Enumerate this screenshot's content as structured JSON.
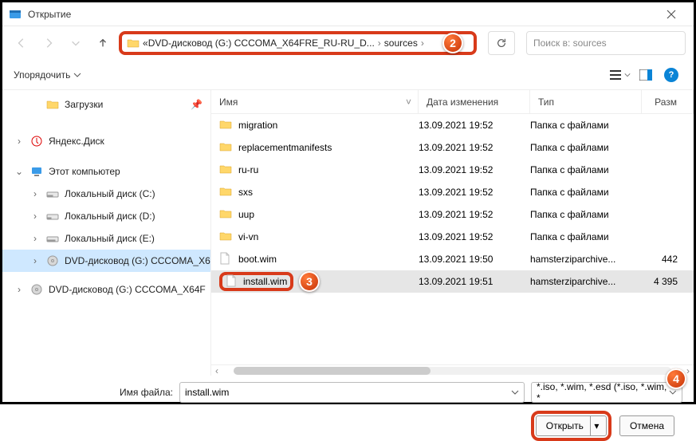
{
  "title": "Открытие",
  "breadcrumb": {
    "prefix": "«",
    "part1": "DVD-дисковод (G:) CCCOMA_X64FRE_RU-RU_D...",
    "part2": "sources"
  },
  "search_placeholder": "Поиск в: sources",
  "organize": "Упорядочить",
  "columns": {
    "name": "Имя",
    "date": "Дата изменения",
    "type": "Тип",
    "size": "Разм"
  },
  "tree": {
    "downloads": "Загрузки",
    "yandex": "Яндекс.Диск",
    "thispc": "Этот компьютер",
    "diskC": "Локальный диск (C:)",
    "diskD": "Локальный диск (D:)",
    "diskE": "Локальный диск (E:)",
    "dvd1": "DVD-дисковод (G:) CCCOMA_X6",
    "dvd2": "DVD-дисковод (G:) CCCOMA_X64F"
  },
  "files": [
    {
      "name": "migration",
      "date": "13.09.2021 19:52",
      "type": "Папка с файлами",
      "size": "",
      "kind": "folder"
    },
    {
      "name": "replacementmanifests",
      "date": "13.09.2021 19:52",
      "type": "Папка с файлами",
      "size": "",
      "kind": "folder"
    },
    {
      "name": "ru-ru",
      "date": "13.09.2021 19:52",
      "type": "Папка с файлами",
      "size": "",
      "kind": "folder"
    },
    {
      "name": "sxs",
      "date": "13.09.2021 19:52",
      "type": "Папка с файлами",
      "size": "",
      "kind": "folder"
    },
    {
      "name": "uup",
      "date": "13.09.2021 19:52",
      "type": "Папка с файлами",
      "size": "",
      "kind": "folder"
    },
    {
      "name": "vi-vn",
      "date": "13.09.2021 19:52",
      "type": "Папка с файлами",
      "size": "",
      "kind": "folder"
    },
    {
      "name": "boot.wim",
      "date": "13.09.2021 19:50",
      "type": "hamsterziparchive...",
      "size": "442",
      "kind": "file"
    },
    {
      "name": "install.wim",
      "date": "13.09.2021 19:51",
      "type": "hamsterziparchive...",
      "size": "4 395",
      "kind": "file",
      "selected": true,
      "highlighted": true
    }
  ],
  "filename_label": "Имя файла:",
  "filename_value": "install.wim",
  "filter_text": "*.iso, *.wim, *.esd (*.iso, *.wim, *",
  "btn_open": "Открыть",
  "btn_cancel": "Отмена"
}
